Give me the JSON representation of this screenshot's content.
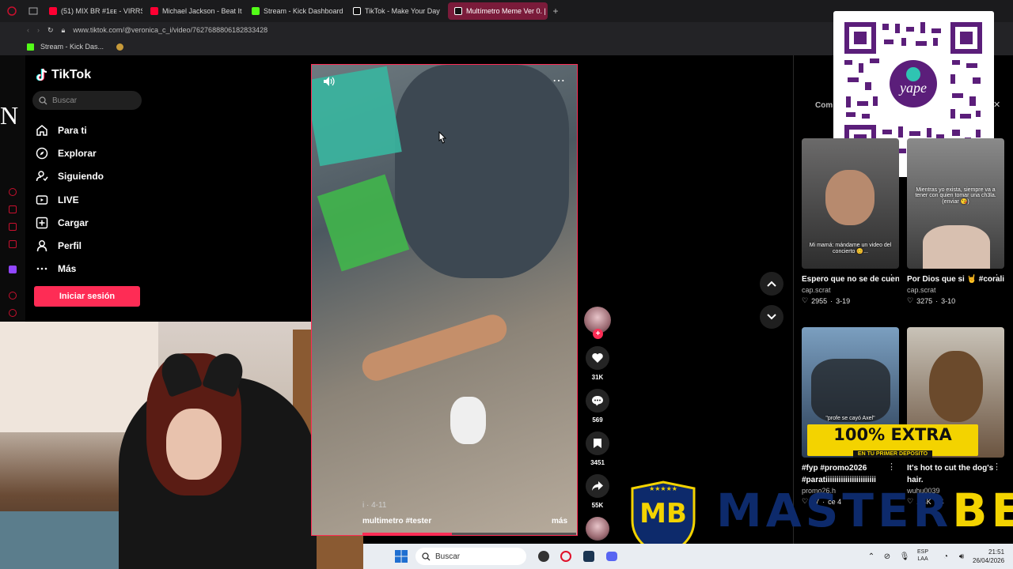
{
  "browser": {
    "tabs": [
      {
        "label": "(51) MIX BR #1ᴇᴇ - VIRRSH",
        "icon": "youtube-icon",
        "color": "#ff0033"
      },
      {
        "label": "Michael Jackson - Beat It",
        "icon": "youtube-icon",
        "color": "#ff0033"
      },
      {
        "label": "Stream - Kick Dashboard",
        "icon": "kick-icon",
        "color": "#53fc18"
      },
      {
        "label": "TikTok - Make Your Day",
        "icon": "tiktok-icon",
        "color": "#ffffff"
      },
      {
        "label": "Multímetro Meme Ver 0. |",
        "icon": "tiktok-icon",
        "color": "#ffffff"
      }
    ],
    "url": "www.tiktok.com/@veronica_c_i/video/7627688806182833428",
    "bookmark": "Stream - Kick Das..."
  },
  "overlay": {
    "left_letter": "N"
  },
  "sidebar": {
    "logo": "TikTok",
    "search_placeholder": "Buscar",
    "items": [
      {
        "label": "Para ti",
        "icon": "home-icon"
      },
      {
        "label": "Explorar",
        "icon": "compass-icon"
      },
      {
        "label": "Siguiendo",
        "icon": "following-icon"
      },
      {
        "label": "LIVE",
        "icon": "live-icon"
      },
      {
        "label": "Cargar",
        "icon": "upload-icon"
      },
      {
        "label": "Perfil",
        "icon": "profile-icon"
      },
      {
        "label": "Más",
        "icon": "more-icon"
      }
    ],
    "login": "Iniciar sesión"
  },
  "video": {
    "caption": "multimetro #tester",
    "date": "i · 4-11",
    "more": "más",
    "progress": 0.42
  },
  "actions": {
    "likes": "31K",
    "comments": "569",
    "saves": "3451",
    "shares": "55K"
  },
  "panel": {
    "comments_label": "Com"
  },
  "related": [
    {
      "title": "Espero que no se de cuenta😂 #humor #...",
      "author": "cap.scrat",
      "likes": "2955",
      "date": "3-19",
      "thumb_text": "Mi mamá: mándame un video del concierto 😊...",
      "color": "#6b6a6a"
    },
    {
      "title": "Por Dios que si 🤘 #corali...",
      "author": "cap.scrat",
      "likes": "3275",
      "date": "3-10",
      "thumb_text": "Mientras yo exista, siempre va a tener con quien tomar una ch3la. (enviar 😘)",
      "color": "#7a7a7a"
    },
    {
      "title": "#fyp #promo2026 #paratiiiiiiiiiiiiiiiiiiiiiii",
      "author": "promo26.h",
      "likes": "37",
      "date": "ce 4",
      "thumb_text": "\"profe se cayó Axel\"",
      "color": "#4a6a8a"
    },
    {
      "title": "It's hot to cut the dog's hair.",
      "author": "wuhu0039",
      "likes": "1.4K",
      "date": "4",
      "thumb_text": "",
      "color": "#8a7358"
    }
  ],
  "promo": {
    "main": "100% EXTRA",
    "sub": "EN TU PRIMER DEPÓSITO",
    "brand_left": "MASTER",
    "brand_right": "BETS",
    "shield_text": "MB",
    "stars": "★★★★★"
  },
  "taskbar": {
    "search": "Buscar",
    "lang_1": "ESP",
    "lang_2": "LAA",
    "time": "21:51",
    "date": "26/04/2026"
  }
}
